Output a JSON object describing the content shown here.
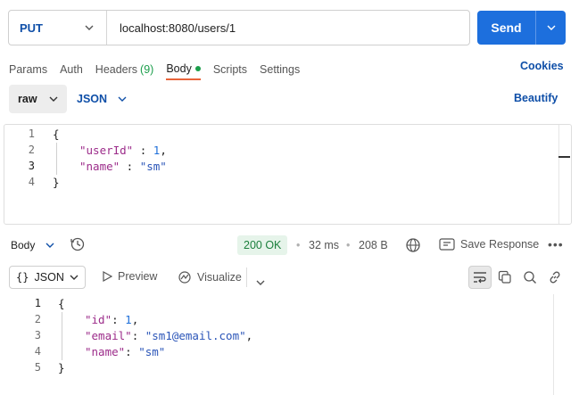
{
  "request": {
    "method": "PUT",
    "url": "localhost:8080/users/1",
    "send_label": "Send"
  },
  "tabs": [
    {
      "label": "Params"
    },
    {
      "label": "Auth"
    },
    {
      "label": "Headers",
      "count": "(9)"
    },
    {
      "label": "Body",
      "active": true
    },
    {
      "label": "Scripts"
    },
    {
      "label": "Settings"
    }
  ],
  "cookies_label": "Cookies",
  "body_options": {
    "mode": "raw",
    "language": "JSON",
    "beautify_label": "Beautify"
  },
  "request_body": {
    "line_numbers": [
      "1",
      "2",
      "3",
      "4"
    ],
    "lines": [
      "{",
      "\"userId\"",
      " : ",
      "1",
      ",",
      "\"name\"",
      " : ",
      "\"sm\"",
      "}"
    ]
  },
  "response": {
    "body_label": "Body",
    "status": "200 OK",
    "time": "32 ms",
    "size": "208 B",
    "save_label": "Save Response",
    "format": "JSON",
    "preview_label": "Preview",
    "visualize_label": "Visualize",
    "line_numbers": [
      "1",
      "2",
      "3",
      "4",
      "5"
    ],
    "tokens": {
      "open": "{",
      "id_key": "\"id\"",
      "id_val": "1",
      "email_key": "\"email\"",
      "email_val": "\"sm1@email.com\"",
      "name_key": "\"name\"",
      "name_val": "\"sm\"",
      "close": "}"
    }
  },
  "colors": {
    "accent": "#1d6fdd",
    "method": "#0f4fa8",
    "status_ok": "#1b7f3c",
    "active_tab_underline": "#e8643a"
  },
  "icons": [
    "chevron-down-icon",
    "history-icon",
    "globe-icon",
    "save-icon",
    "more-icon",
    "play-icon",
    "visualize-icon",
    "wrap-icon",
    "copy-icon",
    "search-icon",
    "link-icon"
  ]
}
